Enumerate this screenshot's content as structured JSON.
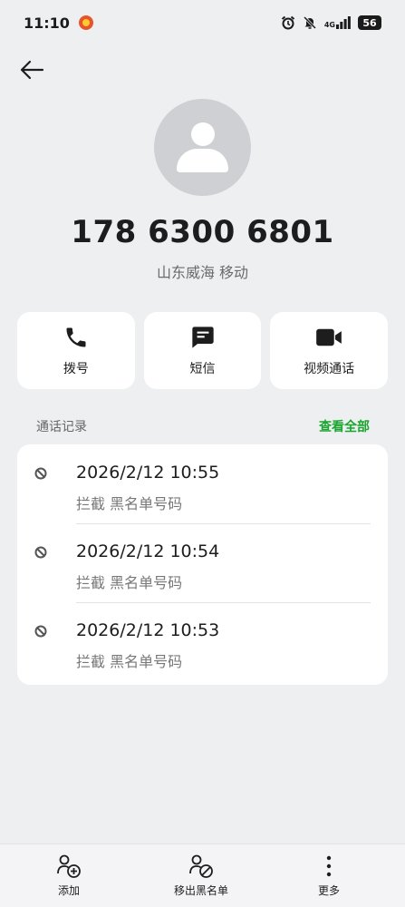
{
  "status_bar": {
    "time": "11:10",
    "network": "4G",
    "battery": "56"
  },
  "contact": {
    "phone_number": "178 6300 6801",
    "location": "山东威海 移动"
  },
  "actions": [
    {
      "label": "拨号",
      "icon": "phone-icon"
    },
    {
      "label": "短信",
      "icon": "message-icon"
    },
    {
      "label": "视频通话",
      "icon": "video-icon"
    }
  ],
  "call_log": {
    "title": "通话记录",
    "view_all": "查看全部",
    "items": [
      {
        "time": "2026/2/12 10:55",
        "desc": "拦截  黑名单号码",
        "icon": "blocked-icon"
      },
      {
        "time": "2026/2/12 10:54",
        "desc": "拦截  黑名单号码",
        "icon": "blocked-icon"
      },
      {
        "time": "2026/2/12 10:53",
        "desc": "拦截  黑名单号码",
        "icon": "blocked-icon"
      }
    ]
  },
  "bottom_bar": {
    "add": "添加",
    "remove_blacklist": "移出黑名单",
    "more": "更多"
  },
  "colors": {
    "accent_green": "#1aa52f",
    "background": "#eeeff1"
  }
}
